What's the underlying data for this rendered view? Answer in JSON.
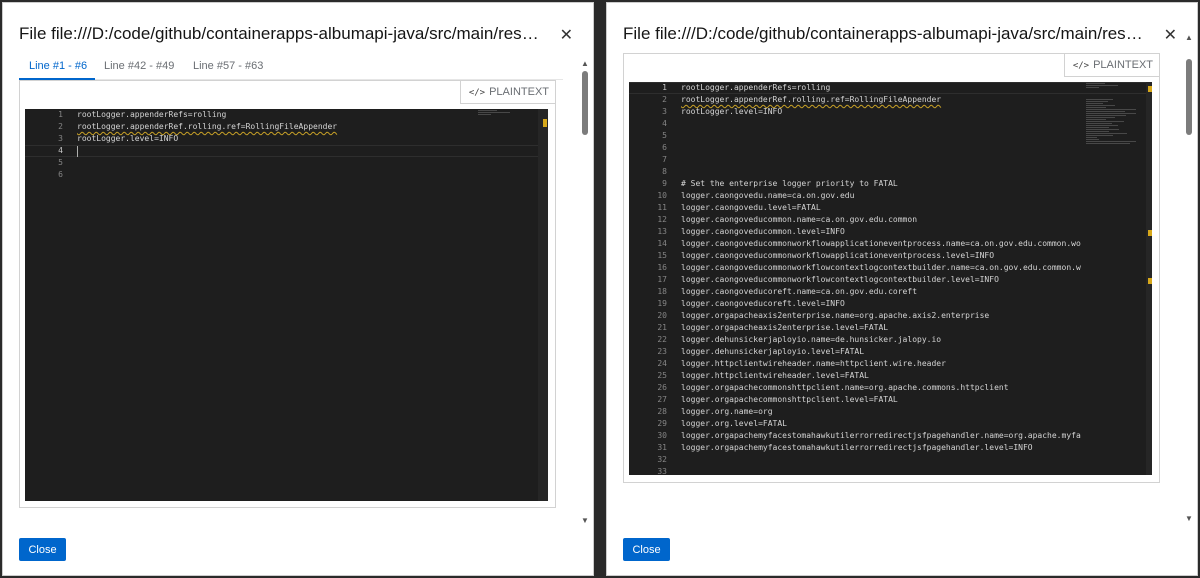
{
  "left": {
    "title": "File file:///D:/code/github/containerapps-albumapi-java/src/main/resources...",
    "tabs": [
      {
        "label": "Line #1 - #6",
        "active": true
      },
      {
        "label": "Line #42 - #49",
        "active": false
      },
      {
        "label": "Line #57 - #63",
        "active": false
      }
    ],
    "language": "PLAINTEXT",
    "lines": [
      {
        "n": "1",
        "t": "rootLogger.appenderRefs=rolling"
      },
      {
        "n": "2",
        "t": "rootLogger.appenderRef.rolling.ref=RollingFileAppender"
      },
      {
        "n": "3",
        "t": "rootLogger.level=INFO"
      },
      {
        "n": "4",
        "t": ""
      },
      {
        "n": "5",
        "t": ""
      },
      {
        "n": "6",
        "t": ""
      }
    ],
    "close_label": "Close"
  },
  "right": {
    "title": "File file:///D:/code/github/containerapps-albumapi-java/src/main/resources...",
    "language": "PLAINTEXT",
    "lines": [
      {
        "n": "1",
        "t": "rootLogger.appenderRefs=rolling"
      },
      {
        "n": "2",
        "t": "rootLogger.appenderRef.rolling.ref=RollingFileAppender"
      },
      {
        "n": "3",
        "t": "rootLogger.level=INFO"
      },
      {
        "n": "4",
        "t": ""
      },
      {
        "n": "5",
        "t": ""
      },
      {
        "n": "6",
        "t": ""
      },
      {
        "n": "7",
        "t": ""
      },
      {
        "n": "8",
        "t": ""
      },
      {
        "n": "9",
        "t": "# Set the enterprise logger priority to FATAL"
      },
      {
        "n": "10",
        "t": "logger.caongovedu.name=ca.on.gov.edu"
      },
      {
        "n": "11",
        "t": "logger.caongovedu.level=FATAL"
      },
      {
        "n": "12",
        "t": "logger.caongoveducommon.name=ca.on.gov.edu.common"
      },
      {
        "n": "13",
        "t": "logger.caongoveducommon.level=INFO"
      },
      {
        "n": "14",
        "t": "logger.caongoveducommonworkflowapplicationeventprocess.name=ca.on.gov.edu.common.wo"
      },
      {
        "n": "15",
        "t": "logger.caongoveducommonworkflowapplicationeventprocess.level=INFO"
      },
      {
        "n": "16",
        "t": "logger.caongoveducommonworkflowcontextlogcontextbuilder.name=ca.on.gov.edu.common.w"
      },
      {
        "n": "17",
        "t": "logger.caongoveducommonworkflowcontextlogcontextbuilder.level=INFO"
      },
      {
        "n": "18",
        "t": "logger.caongoveducoreft.name=ca.on.gov.edu.coreft"
      },
      {
        "n": "19",
        "t": "logger.caongoveducoreft.level=INFO"
      },
      {
        "n": "20",
        "t": "logger.orgapacheaxis2enterprise.name=org.apache.axis2.enterprise"
      },
      {
        "n": "21",
        "t": "logger.orgapacheaxis2enterprise.level=FATAL"
      },
      {
        "n": "22",
        "t": "logger.dehunsickerjaployio.name=de.hunsicker.jalopy.io"
      },
      {
        "n": "23",
        "t": "logger.dehunsickerjaployio.level=FATAL"
      },
      {
        "n": "24",
        "t": "logger.httpclientwireheader.name=httpclient.wire.header"
      },
      {
        "n": "25",
        "t": "logger.httpclientwireheader.level=FATAL"
      },
      {
        "n": "26",
        "t": "logger.orgapachecommonshttpclient.name=org.apache.commons.httpclient"
      },
      {
        "n": "27",
        "t": "logger.orgapachecommonshttpclient.level=FATAL"
      },
      {
        "n": "28",
        "t": "logger.org.name=org"
      },
      {
        "n": "29",
        "t": "logger.org.level=FATAL"
      },
      {
        "n": "30",
        "t": "logger.orgapachemyfacestomahawkutilerrorredirectjsfpagehandler.name=org.apache.myfa"
      },
      {
        "n": "31",
        "t": "logger.orgapachemyfacestomahawkutilerrorredirectjsfpagehandler.level=INFO"
      },
      {
        "n": "32",
        "t": ""
      },
      {
        "n": "33",
        "t": ""
      }
    ],
    "close_label": "Close"
  },
  "icons": {
    "close": "close-icon",
    "code": "code-icon"
  },
  "colors": {
    "accent": "#0066cc",
    "editor_bg": "#1e1e1e",
    "warning": "#d7a81b"
  }
}
